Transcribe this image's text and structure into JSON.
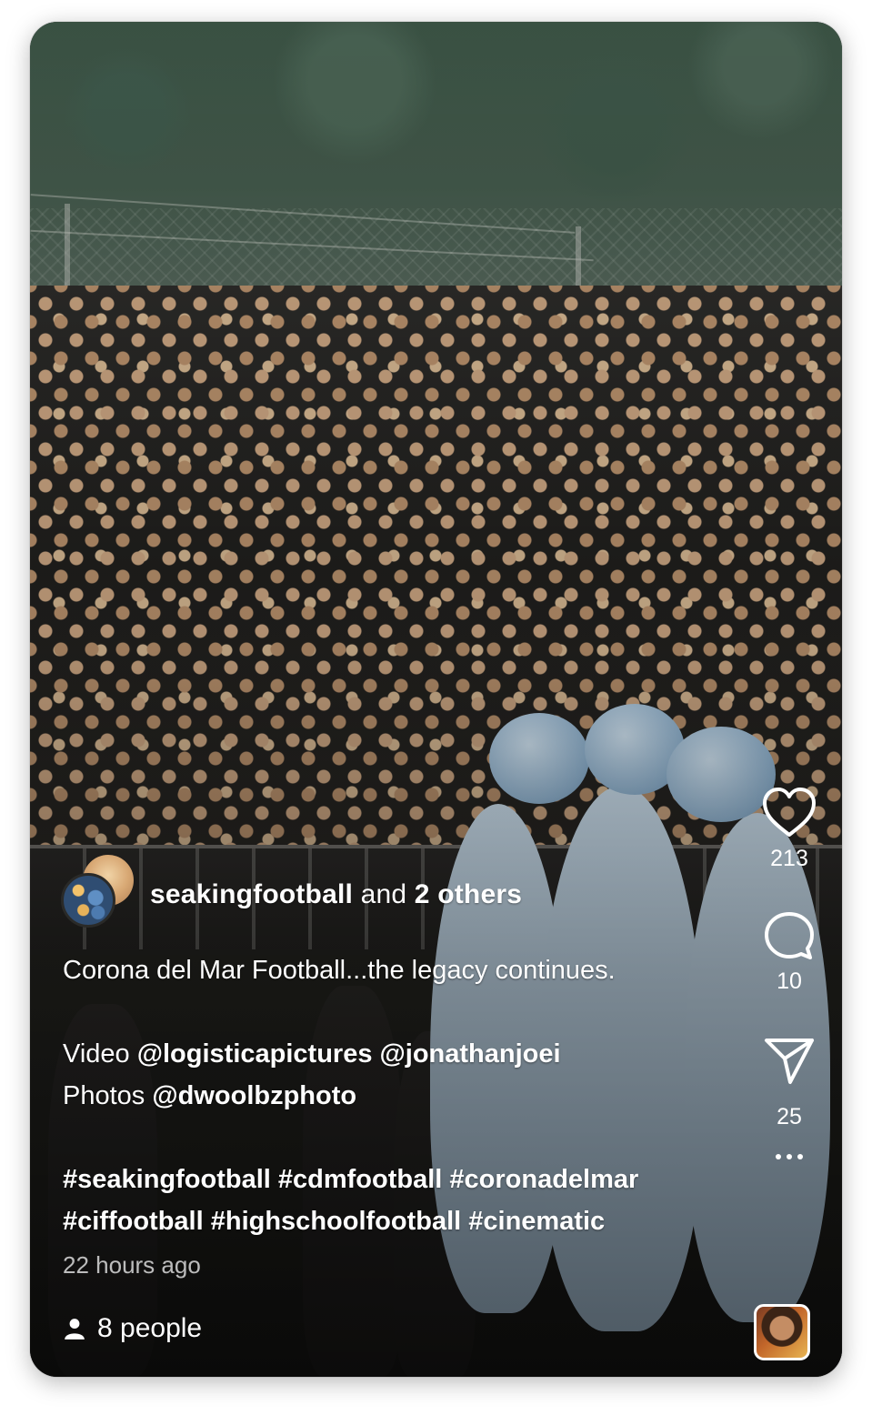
{
  "post": {
    "author_primary": "seakingfootball",
    "author_joiner": " and ",
    "author_others": "2 others",
    "caption_line1": "Corona del Mar Football...the legacy continues.",
    "video_label": "Video ",
    "video_mention1": "@logisticapictures",
    "video_mention2": " @jonathanjoei",
    "photos_label": "Photos ",
    "photos_mention": "@dwoolbzphoto",
    "hashtags_line1": "#seakingfootball #cdmfootball #coronadelmar",
    "hashtags_line2": "#ciffootball #highschoolfootball #cinematic",
    "timestamp": "22 hours ago",
    "viewers": "8 people"
  },
  "actions": {
    "likes": "213",
    "comments": "10",
    "shares": "25"
  },
  "icons": {
    "like": "heart-icon",
    "comment": "comment-bubble-icon",
    "share": "paper-plane-icon",
    "more": "more-dots-icon",
    "viewers": "person-icon",
    "audio": "audio-thumbnail"
  },
  "colors": {
    "text": "#ffffff",
    "muted_text": "rgba(255,255,255,0.72)"
  }
}
